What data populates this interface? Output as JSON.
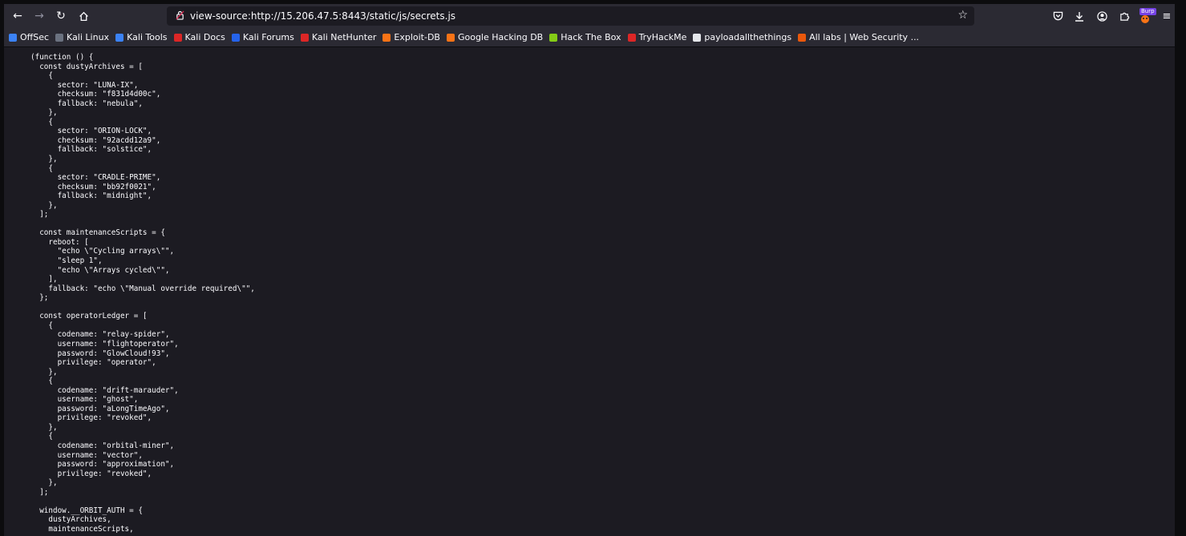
{
  "browser": {
    "url": "view-source:http://15.206.47.5:8443/static/js/secrets.js",
    "ext_badge": "Burp"
  },
  "bookmarks": [
    {
      "label": "OffSec",
      "icon": "offsec-icon",
      "color": "#3b82f6"
    },
    {
      "label": "Kali Linux",
      "icon": "kali-dragon-icon",
      "color": "#6b7280"
    },
    {
      "label": "Kali Tools",
      "icon": "kali-tools-icon",
      "color": "#3b82f6"
    },
    {
      "label": "Kali Docs",
      "icon": "kali-docs-icon",
      "color": "#dc2626"
    },
    {
      "label": "Kali Forums",
      "icon": "kali-forums-icon",
      "color": "#2563eb"
    },
    {
      "label": "Kali NetHunter",
      "icon": "nethunter-icon",
      "color": "#dc2626"
    },
    {
      "label": "Exploit-DB",
      "icon": "exploitdb-icon",
      "color": "#f97316"
    },
    {
      "label": "Google Hacking DB",
      "icon": "ghdb-icon",
      "color": "#f97316"
    },
    {
      "label": "Hack The Box",
      "icon": "htb-cube-icon",
      "color": "#84cc16"
    },
    {
      "label": "TryHackMe",
      "icon": "tryhackme-icon",
      "color": "#dc2626"
    },
    {
      "label": "payloadallthethings",
      "icon": "github-icon",
      "color": "#e5e7eb"
    },
    {
      "label": "All labs | Web Security ...",
      "icon": "portswigger-icon",
      "color": "#ea580c"
    }
  ],
  "source_lines": [
    "(function () {",
    "  const dustyArchives = [",
    "    {",
    "      sector: \"LUNA-IX\",",
    "      checksum: \"f831d4d00c\",",
    "      fallback: \"nebula\",",
    "    },",
    "    {",
    "      sector: \"ORION-LOCK\",",
    "      checksum: \"92acdd12a9\",",
    "      fallback: \"solstice\",",
    "    },",
    "    {",
    "      sector: \"CRADLE-PRIME\",",
    "      checksum: \"bb92f0021\",",
    "      fallback: \"midnight\",",
    "    },",
    "  ];",
    "",
    "  const maintenanceScripts = {",
    "    reboot: [",
    "      \"echo \\\"Cycling arrays\\\"\",",
    "      \"sleep 1\",",
    "      \"echo \\\"Arrays cycled\\\"\",",
    "    ],",
    "    fallback: \"echo \\\"Manual override required\\\"\",",
    "  };",
    "",
    "  const operatorLedger = [",
    "    {",
    "      codename: \"relay-spider\",",
    "      username: \"flightoperator\",",
    "      password: \"GlowCloud!93\",",
    "      privilege: \"operator\",",
    "    },",
    "    {",
    "      codename: \"drift-marauder\",",
    "      username: \"ghost\",",
    "      password: \"aLongTimeAgo\",",
    "      privilege: \"revoked\",",
    "    },",
    "    {",
    "      codename: \"orbital-miner\",",
    "      username: \"vector\",",
    "      password: \"approximation\",",
    "      privilege: \"revoked\",",
    "    },",
    "  ];",
    "",
    "  window.__ORBIT_AUTH = {",
    "    dustyArchives,",
    "    maintenanceScripts,"
  ]
}
